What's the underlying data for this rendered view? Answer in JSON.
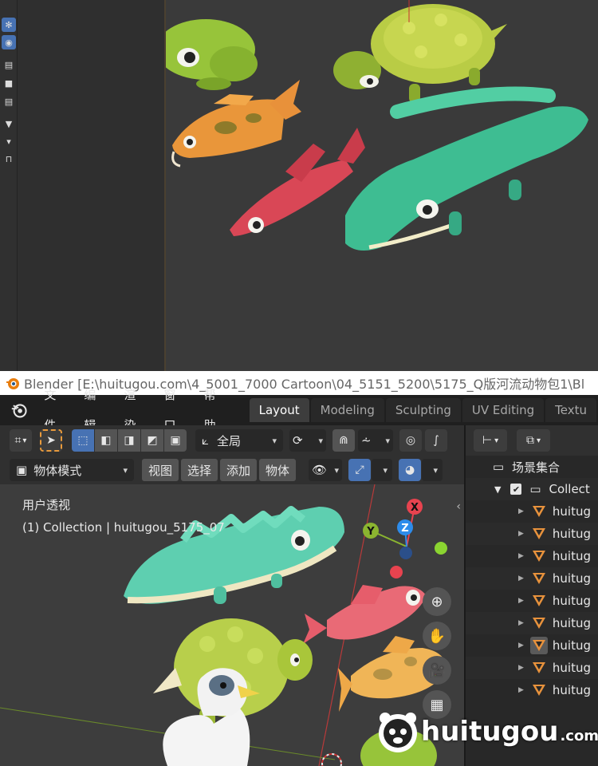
{
  "title_bar": {
    "text": "Blender [E:\\huitugou.com\\4_5001_7000 Cartoon\\04_5151_5200\\5175_Q版河流动物包1\\Bl"
  },
  "menubar": {
    "items": [
      "文件",
      "编辑",
      "渲染",
      "窗口",
      "帮助"
    ],
    "workspace_tabs": [
      {
        "label": "Layout",
        "active": true
      },
      {
        "label": "Modeling",
        "active": false
      },
      {
        "label": "Sculpting",
        "active": false
      },
      {
        "label": "UV Editing",
        "active": false
      },
      {
        "label": "Textu",
        "active": false
      }
    ]
  },
  "viewport_header": {
    "transform_orientation": "全局",
    "mode": "物体模式",
    "menus": [
      "视图",
      "选择",
      "添加",
      "物体"
    ]
  },
  "viewport": {
    "view_name": "用户透视",
    "collection_info": "(1) Collection | huitugou_5175_07",
    "gizmo_axes": [
      "X",
      "Y",
      "Z"
    ]
  },
  "outliner": {
    "scene_collection": "场景集合",
    "collection": "Collect",
    "objects": [
      "huitug",
      "huitug",
      "huitug",
      "huitug",
      "huitug",
      "huitug",
      "huitug",
      "huitug",
      "huitug"
    ]
  },
  "watermark": {
    "text": "huitugou",
    "suffix": ".com"
  },
  "colors": {
    "accent_blue": "#4772b3",
    "object_orange": "#e8923c",
    "axis_x": "#e8434f",
    "axis_y": "#8bb530",
    "axis_z": "#2d8ceb"
  }
}
